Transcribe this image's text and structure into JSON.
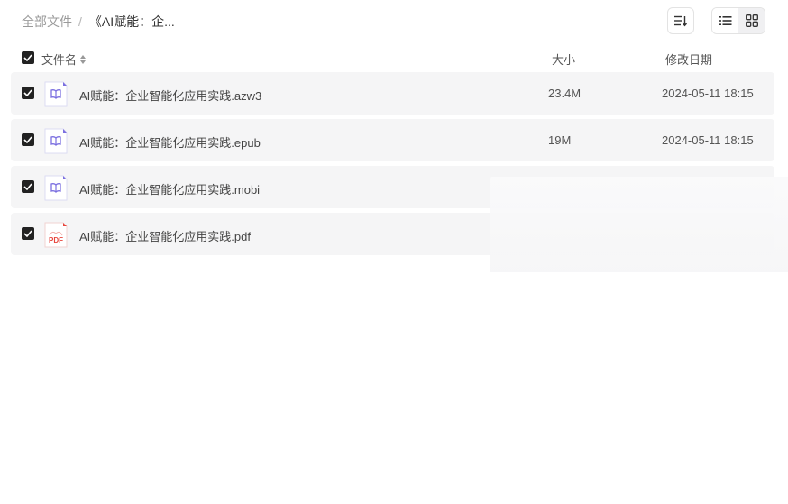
{
  "breadcrumb": {
    "root": "全部文件",
    "separator": "/",
    "current": "《AI赋能：企..."
  },
  "toolbar": {
    "sort_icon": "sort-list-icon",
    "list_view_icon": "list-view-icon",
    "grid_view_icon": "grid-view-icon",
    "active_view": "list"
  },
  "table": {
    "headers": {
      "name": "文件名",
      "size": "大小",
      "date": "修改日期"
    },
    "rows": [
      {
        "name": "AI赋能：企业智能化应用实践.azw3",
        "size": "23.4M",
        "date": "2024-05-11 18:15",
        "icon": "ebook-icon",
        "checked": true
      },
      {
        "name": "AI赋能：企业智能化应用实践.epub",
        "size": "19M",
        "date": "2024-05-11 18:15",
        "icon": "ebook-icon",
        "checked": true
      },
      {
        "name": "AI赋能：企业智能化应用实践.mobi",
        "size": "",
        "date": "",
        "icon": "ebook-icon",
        "checked": true
      },
      {
        "name": "AI赋能：企业智能化应用实践.pdf",
        "size": "",
        "date": "",
        "icon": "pdf-icon",
        "checked": true
      }
    ]
  },
  "colors": {
    "row_bg": "#f5f5f6",
    "ebook_purple": "#7b6fe0",
    "pdf_red": "#e8453c",
    "checkbox": "#222222"
  }
}
